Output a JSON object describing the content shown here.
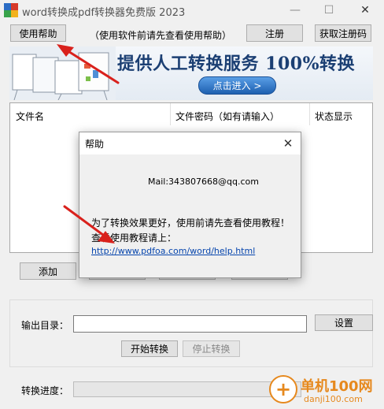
{
  "window": {
    "title": "word转换成pdf转换器免费版 2023",
    "minimize_glyph": "—",
    "maximize_glyph": "☐",
    "close_glyph": "✕"
  },
  "toolbar": {
    "help_label": "使用帮助",
    "hint": "（使用软件前请先查看使用帮助）",
    "register_label": "注册",
    "get_code_label": "获取注册码"
  },
  "banner": {
    "headline": "提供人工转换服务 100%转换",
    "enter_label": "点击进入 >"
  },
  "file_table": {
    "columns": [
      "文件名",
      "文件密码（如有请输入）",
      "状态显示"
    ]
  },
  "actions": {
    "add_label": "添加"
  },
  "output": {
    "dir_label": "输出目录：",
    "dir_value": "",
    "settings_label": "设置",
    "start_label": "开始转换",
    "stop_label": "停止转换"
  },
  "progress": {
    "label": "转换进度：",
    "value": 0
  },
  "help_dialog": {
    "title": "帮助",
    "mail": "Mail:343807668@qq.com",
    "line1": "为了转换效果更好，使用前请先查看使用教程！",
    "line2": "查看使用教程请上：",
    "url": "http://www.pdfoa.com/word/help.html"
  },
  "watermark": {
    "text": "单机100网",
    "domain": "danji100.com"
  },
  "colors": {
    "banner_text": "#1b3f73",
    "link": "#0645ad",
    "annotation_arrow": "#d9211c",
    "watermark": "#e6891e"
  }
}
